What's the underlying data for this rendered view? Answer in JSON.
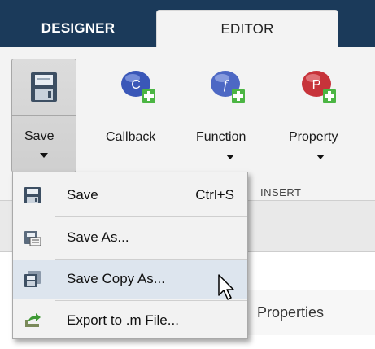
{
  "tabs": {
    "designer": "DESIGNER",
    "editor": "EDITOR"
  },
  "toolstrip": {
    "save_label": "Save",
    "callback_label": "Callback",
    "function_label": "Function",
    "property_label": "Property",
    "insert_group_label": "INSERT",
    "callback_badge": "C",
    "function_badge": "f",
    "property_badge": "P"
  },
  "save_menu": {
    "items": [
      {
        "label": "Save",
        "shortcut": "Ctrl+S",
        "icon": "floppy-disk-icon"
      },
      {
        "label": "Save As...",
        "icon": "save-as-icon"
      },
      {
        "label": "Save Copy As...",
        "icon": "save-copy-icon",
        "highlighted": true
      },
      {
        "label": "Export to .m File...",
        "icon": "export-arrow-icon"
      }
    ]
  },
  "panels": {
    "properties_tab": "Properties"
  },
  "colors": {
    "tab_bar": "#1b3a5a",
    "callback_icon": "#3a57b8",
    "function_icon": "#4d68c4",
    "property_icon": "#c7333a",
    "plus_badge": "#4bb543",
    "menu_highlight": "#dde5ee"
  }
}
